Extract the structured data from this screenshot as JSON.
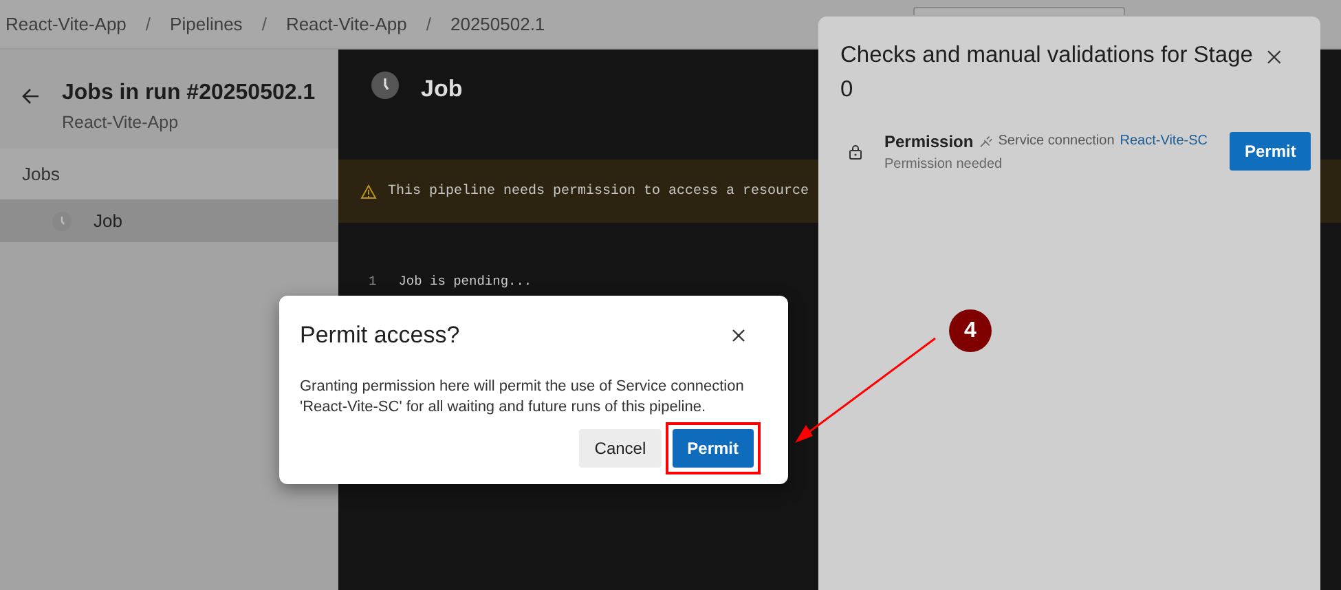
{
  "breadcrumb": {
    "separator": "/",
    "items": [
      "React-Vite-App",
      "Pipelines",
      "React-Vite-App",
      "20250502.1"
    ]
  },
  "jobs_pane": {
    "title": "Jobs in run #20250502.1",
    "subtitle": "React-Vite-App",
    "section": "Jobs",
    "jobs": [
      {
        "name": "Job",
        "selected": true
      }
    ]
  },
  "job_view": {
    "title": "Job",
    "warning": "This pipeline needs permission to access a resource",
    "log_lines": [
      {
        "number": "1",
        "text": "Job is pending..."
      }
    ]
  },
  "checks_panel": {
    "title": "Checks and manual validations for Stage 0",
    "checks": [
      {
        "name": "Permission",
        "resource_type": "Service connection",
        "resource": "React-Vite-SC",
        "status": "Permission needed",
        "action": "Permit"
      }
    ]
  },
  "dialog": {
    "title": "Permit access?",
    "message": "Granting permission here will permit the use of Service connection 'React-Vite-SC' for all waiting and future runs of this pipeline.",
    "buttons": [
      {
        "label": "Cancel",
        "kind": "secondary",
        "highlighted": false
      },
      {
        "label": "Permit",
        "kind": "primary",
        "highlighted": true
      }
    ]
  },
  "annotation": {
    "number": "4"
  }
}
